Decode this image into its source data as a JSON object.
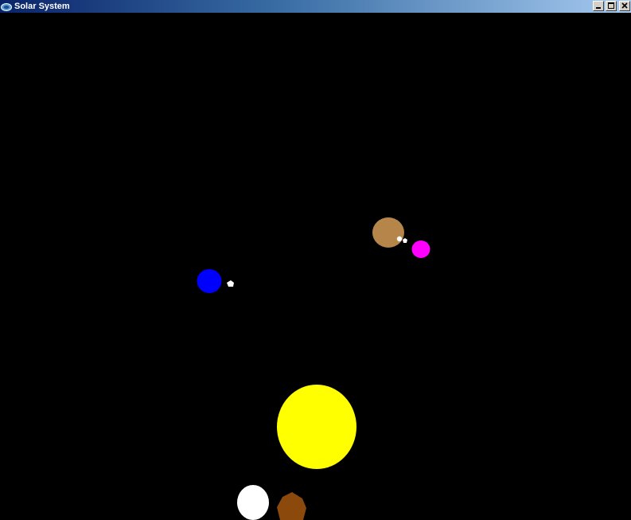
{
  "window": {
    "title": "Solar System",
    "icon": "app-icon"
  },
  "title_buttons": {
    "minimize_icon": "minimize-icon",
    "maximize_icon": "maximize-icon",
    "close_icon": "close-icon"
  },
  "scene": {
    "background_color": "#000000",
    "bodies": [
      {
        "name": "sun",
        "color": "#ffff00"
      },
      {
        "name": "blue-planet",
        "color": "#0000ff"
      },
      {
        "name": "blue-planet-moon",
        "color": "#ffffff"
      },
      {
        "name": "tan-planet",
        "color": "#b5854a"
      },
      {
        "name": "tan-planet-moon-1",
        "color": "#ffffff"
      },
      {
        "name": "tan-planet-moon-2",
        "color": "#ffffff"
      },
      {
        "name": "magenta-planet",
        "color": "#ff00ff"
      },
      {
        "name": "white-planet",
        "color": "#ffffff"
      },
      {
        "name": "brown-planet",
        "color": "#8b4a0c"
      }
    ]
  }
}
